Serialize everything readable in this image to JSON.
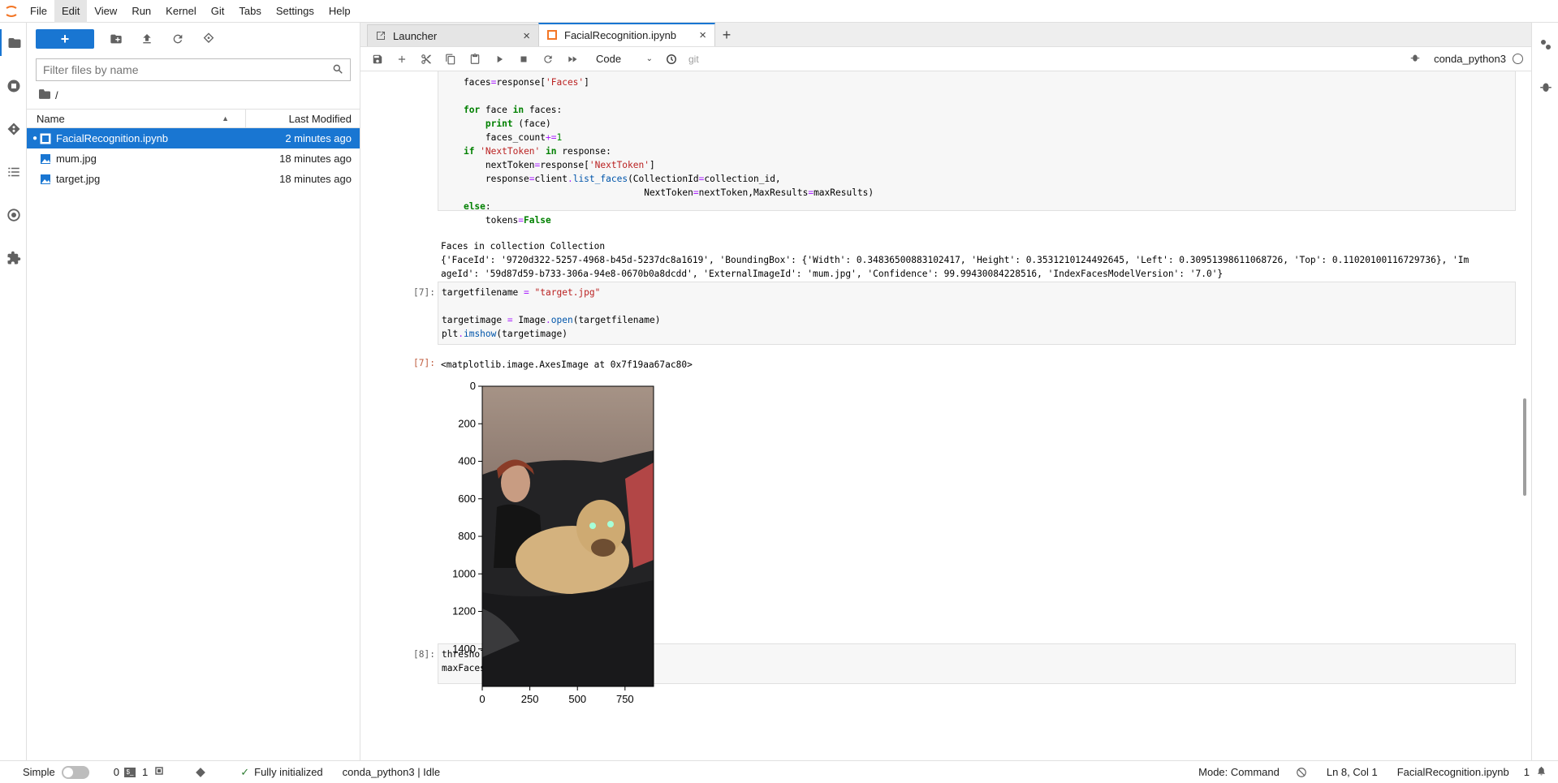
{
  "menubar": {
    "items": [
      "File",
      "Edit",
      "View",
      "Run",
      "Kernel",
      "Git",
      "Tabs",
      "Settings",
      "Help"
    ],
    "active": "Edit"
  },
  "left_strip": {
    "icons": [
      "folder-icon",
      "running-icon",
      "git-icon",
      "toc-icon",
      "extension-manager-icon",
      "puzzle-icon"
    ]
  },
  "right_strip": {
    "icons": [
      "property-inspector-icon",
      "debugger-icon"
    ]
  },
  "file_browser": {
    "new_label": "+",
    "search_placeholder": "Filter files by name",
    "breadcrumb": "/",
    "col_name": "Name",
    "col_modified": "Last Modified",
    "files": [
      {
        "name": "FacialRecognition.ipynb",
        "modified": "2 minutes ago",
        "type": "notebook",
        "selected": true,
        "running": true
      },
      {
        "name": "mum.jpg",
        "modified": "18 minutes ago",
        "type": "image",
        "selected": false,
        "running": false
      },
      {
        "name": "target.jpg",
        "modified": "18 minutes ago",
        "type": "image",
        "selected": false,
        "running": false
      }
    ]
  },
  "tabs": [
    {
      "label": "Launcher",
      "icon": "launcher-icon",
      "active": false
    },
    {
      "label": "FacialRecognition.ipynb",
      "icon": "notebook-icon",
      "active": true
    }
  ],
  "nb_toolbar": {
    "cell_type": "Code",
    "git_label": "git",
    "kernel_name": "conda_python3"
  },
  "notebook": {
    "cell6_output_line1": "Faces in collection Collection",
    "cell6_output_line2": "{'FaceId': '9720d322-5257-4968-b45d-5237dc8a1619', 'BoundingBox': {'Width': 0.34836500883102417, 'Height': 0.3531210124492645, 'Left': 0.30951398611068726, 'Top': 0.11020100116729736}, 'Im",
    "cell6_output_line3": "ageId': '59d87d59-b733-306a-94e8-0670b0a8dcdd', 'ExternalImageId': 'mum.jpg', 'Confidence': 99.99430084228516, 'IndexFacesModelVersion': '7.0'}",
    "cell7_prompt": "[7]:",
    "cell7_out_prompt": "[7]:",
    "cell7_output": "<matplotlib.image.AxesImage at 0x7f19aa67ac80>",
    "cell8_prompt": "[8]:"
  },
  "plot": {
    "y_ticks": [
      "0",
      "200",
      "400",
      "600",
      "800",
      "1000",
      "1200",
      "1400"
    ],
    "x_ticks": [
      "0",
      "250",
      "500",
      "750"
    ]
  },
  "statusbar": {
    "mode_label": "Simple",
    "terminals_count": "0",
    "kernels_count": "1",
    "init_status": "Fully initialized",
    "kernel_status": "conda_python3 | Idle",
    "command_mode": "Mode: Command",
    "cursor_pos": "Ln 8, Col 1",
    "file_name": "FacialRecognition.ipynb",
    "notification_count": "1"
  }
}
